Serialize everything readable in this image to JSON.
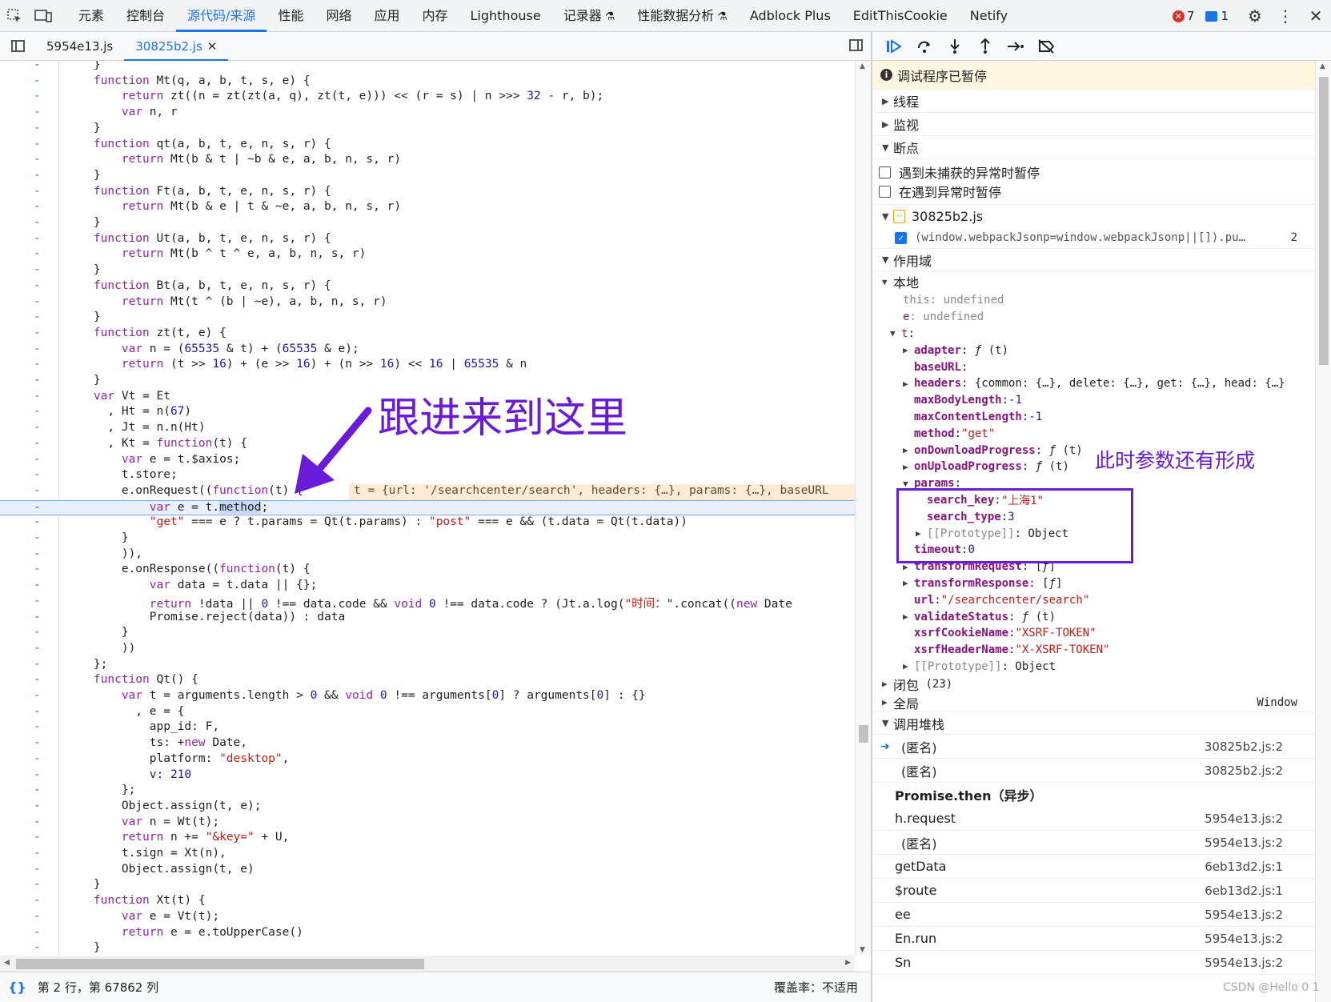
{
  "toolbar": {
    "tabs": [
      "元素",
      "控制台",
      "源代码/来源",
      "性能",
      "网络",
      "应用",
      "内存",
      "Lighthouse",
      "记录器",
      "性能数据分析",
      "Adblock Plus",
      "EditThisCookie",
      "Netify"
    ],
    "active_tab": "源代码/来源",
    "error_count": "7",
    "message_count": "1"
  },
  "files": {
    "tabs": [
      "5954e13.js",
      "30825b2.js"
    ],
    "active": "30825b2.js"
  },
  "code": {
    "inline_hint": "t = {url: '/searchcenter/search', headers: {…}, params: {…}, baseURL",
    "annotation": "跟进来到这里"
  },
  "status": {
    "position": "第 2 行，第 67862 列",
    "coverage": "覆盖率：不适用"
  },
  "debugger": {
    "paused_text": "调试程序已暂停",
    "sections": {
      "threads": "线程",
      "watch": "监视",
      "breakpoints": "断点",
      "scope": "作用域",
      "callstack": "调用堆栈"
    },
    "pause_uncaught": "遇到未捕获的异常时暂停",
    "pause_caught": "在遇到异常时暂停",
    "bp_file": "30825b2.js",
    "bp_code": "(window.webpackJsonp=window.webpackJsonp||[]).pu…",
    "bp_line": "2",
    "scope": {
      "local": "本地",
      "closure": "闭包",
      "closure_count": "(23)",
      "global": "全局",
      "global_value": "Window"
    },
    "annotation": "此时参数还有形成",
    "callstack": [
      {
        "name": "(匿名)",
        "loc": "30825b2.js:2",
        "current": true,
        "indent": true
      },
      {
        "name": "(匿名)",
        "loc": "30825b2.js:2",
        "indent": true
      },
      {
        "name": "Promise.then（异步）",
        "async": true
      },
      {
        "name": "h.request",
        "loc": "5954e13.js:2"
      },
      {
        "name": "(匿名)",
        "loc": "5954e13.js:2",
        "indent": true
      },
      {
        "name": "getData",
        "loc": "6eb13d2.js:1"
      },
      {
        "name": "$route",
        "loc": "6eb13d2.js:1"
      },
      {
        "name": "ee",
        "loc": "5954e13.js:2"
      },
      {
        "name": "En.run",
        "loc": "5954e13.js:2"
      },
      {
        "name": "Sn",
        "loc": "5954e13.js:2"
      }
    ]
  },
  "watermark": "CSDN @Hello 0 1"
}
